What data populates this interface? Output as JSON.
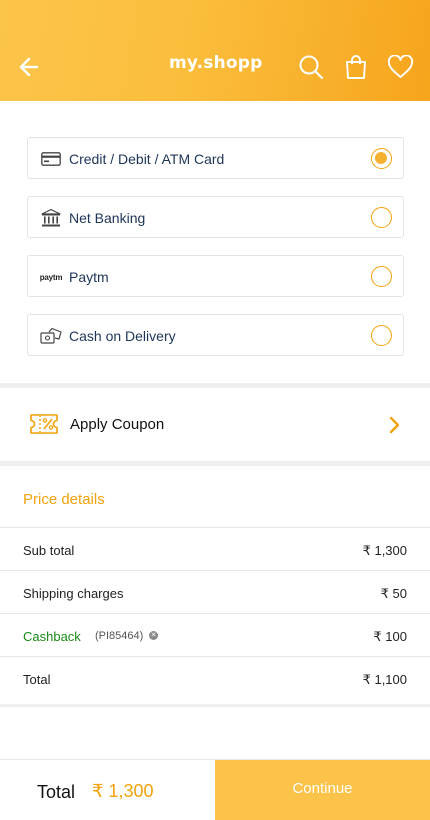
{
  "header": {
    "brand": "my.shopp",
    "icons": [
      "back-arrow-icon",
      "search-icon",
      "shopping-bag-icon",
      "heart-icon"
    ]
  },
  "payment_options": [
    {
      "label": "Credit / Debit / ATM Card",
      "icon": "credit-card-icon",
      "selected": true
    },
    {
      "label": "Net Banking",
      "icon": "bank-icon",
      "selected": false
    },
    {
      "label": "Paytm",
      "icon": "paytm-logo",
      "icon_text": "paytm",
      "selected": false
    },
    {
      "label": "Cash on Delivery",
      "icon": "cash-icon",
      "selected": false
    }
  ],
  "coupon": {
    "label": "Apply Coupon",
    "icon": "coupon-icon"
  },
  "price_details": {
    "title": "Price details",
    "rows": [
      {
        "label": "Sub total",
        "value": "₹ 1,300"
      },
      {
        "label": "Shipping charges",
        "value": "₹ 50"
      },
      {
        "label": "Cashback",
        "code": "(PI85464)",
        "value": "₹ 100"
      },
      {
        "label": "Total",
        "value": "₹ 1,100"
      }
    ]
  },
  "footer": {
    "total_label": "Total",
    "total_amount": "₹ 1,300",
    "continue_label": "Continue"
  },
  "colors": {
    "accent": "#f2a20c",
    "header_gradient_start": "#fbc54a",
    "header_gradient_end": "#f6a51c",
    "cashback": "#1a8a1a",
    "continue_bg": "#fcc34a"
  }
}
